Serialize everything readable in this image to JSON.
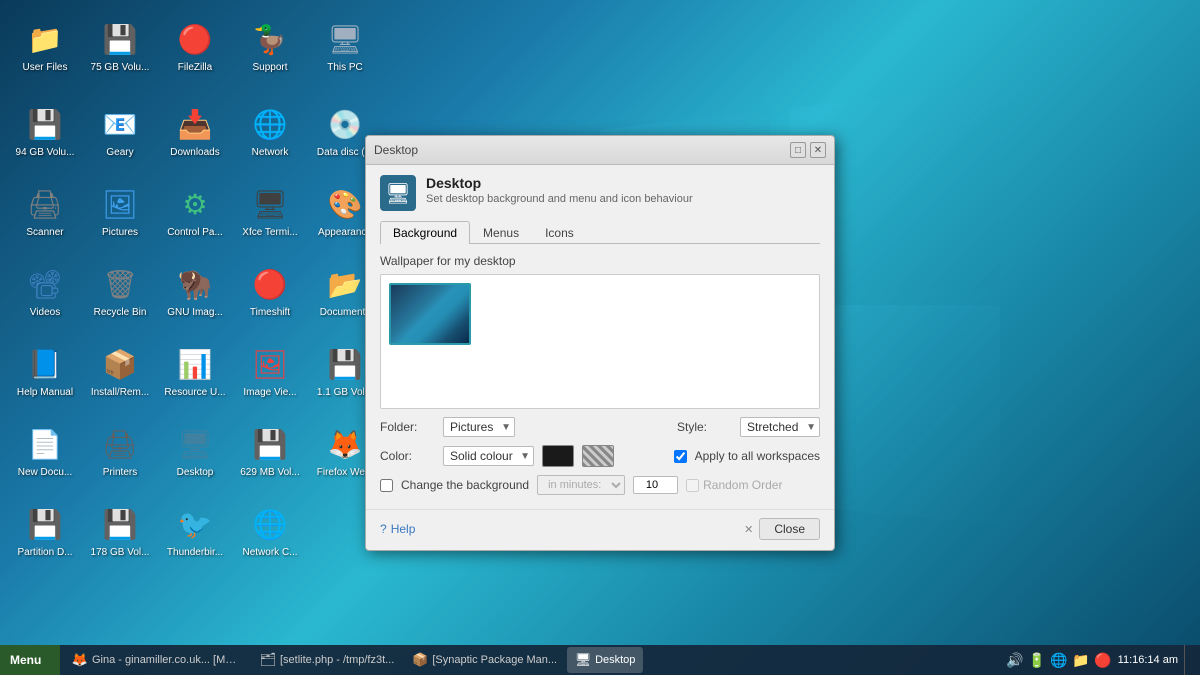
{
  "desktop": {
    "bg_color": "#1a6a8a",
    "icons": [
      {
        "id": "user-files",
        "label": "User Files",
        "emoji": "📁",
        "class": "icon-folder"
      },
      {
        "id": "75gb-vol",
        "label": "75 GB Volu...",
        "emoji": "💾",
        "class": "icon-drive"
      },
      {
        "id": "filezilla",
        "label": "FileZilla",
        "emoji": "🔴",
        "class": "icon-zip"
      },
      {
        "id": "support",
        "label": "Support",
        "emoji": "🦆",
        "class": "icon-support"
      },
      {
        "id": "this-pc",
        "label": "This PC",
        "emoji": "🖥",
        "class": "icon-pc"
      },
      {
        "id": "94gb-vol",
        "label": "94 GB Volu...",
        "emoji": "💾",
        "class": "icon-drive"
      },
      {
        "id": "geary",
        "label": "Geary",
        "emoji": "📧",
        "class": "icon-geary"
      },
      {
        "id": "downloads",
        "label": "Downloads",
        "emoji": "📥",
        "class": "icon-download"
      },
      {
        "id": "network",
        "label": "Network",
        "emoji": "🌐",
        "class": "icon-network"
      },
      {
        "id": "data-disc",
        "label": "Data disc (...",
        "emoji": "💿",
        "class": "icon-disc"
      },
      {
        "id": "scanner",
        "label": "Scanner",
        "emoji": "🖨",
        "class": "icon-scanner"
      },
      {
        "id": "pictures",
        "label": "Pictures",
        "emoji": "🖼",
        "class": "icon-pictures"
      },
      {
        "id": "control-panel",
        "label": "Control Pa...",
        "emoji": "⚙",
        "class": "icon-controlpanel"
      },
      {
        "id": "xfce-terminal",
        "label": "Xfce Termi...",
        "emoji": "🖥",
        "class": "icon-terminal"
      },
      {
        "id": "appearance",
        "label": "Appearance",
        "emoji": "🎨",
        "class": "icon-appearance"
      },
      {
        "id": "videos",
        "label": "Videos",
        "emoji": "📽",
        "class": "icon-videos"
      },
      {
        "id": "recycle-bin",
        "label": "Recycle Bin",
        "emoji": "🗑",
        "class": "icon-trash"
      },
      {
        "id": "gnu-image",
        "label": "GNU Imag...",
        "emoji": "🦬",
        "class": "icon-gnuimage"
      },
      {
        "id": "timeshift",
        "label": "Timeshift",
        "emoji": "🔴",
        "class": "icon-timeshift"
      },
      {
        "id": "documents",
        "label": "Documents",
        "emoji": "📂",
        "class": "icon-documents"
      },
      {
        "id": "help-manual",
        "label": "Help Manual",
        "emoji": "📘",
        "class": "icon-help"
      },
      {
        "id": "install-remove",
        "label": "Install/Rem...",
        "emoji": "📦",
        "class": "icon-install"
      },
      {
        "id": "resource-u",
        "label": "Resource U...",
        "emoji": "📊",
        "class": "icon-resource"
      },
      {
        "id": "image-view",
        "label": "Image Vie...",
        "emoji": "🖼",
        "class": "icon-imageview"
      },
      {
        "id": "1gb-vol",
        "label": "1.1 GB Vol...",
        "emoji": "💾",
        "class": "icon-volume"
      },
      {
        "id": "new-doc",
        "label": "New Docu...",
        "emoji": "📄",
        "class": "icon-newdoc"
      },
      {
        "id": "printers",
        "label": "Printers",
        "emoji": "🖨",
        "class": "icon-printers"
      },
      {
        "id": "desktop",
        "label": "Desktop",
        "emoji": "🖥",
        "class": "icon-desktop-icon"
      },
      {
        "id": "629gb-vol",
        "label": "629 MB Vol...",
        "emoji": "💾",
        "class": "icon-volume2"
      },
      {
        "id": "firefox-web",
        "label": "Firefox We...",
        "emoji": "🦊",
        "class": "icon-firefox"
      },
      {
        "id": "partition-d",
        "label": "Partition D...",
        "emoji": "💾",
        "class": "icon-partition"
      },
      {
        "id": "178gb-vol",
        "label": "178 GB Vol...",
        "emoji": "💾",
        "class": "icon-volume2"
      },
      {
        "id": "thunderbird",
        "label": "Thunderbir...",
        "emoji": "🐦",
        "class": "icon-thunderbird"
      },
      {
        "id": "network-c",
        "label": "Network C...",
        "emoji": "🌐",
        "class": "icon-network2"
      }
    ]
  },
  "dialog": {
    "title": "Desktop",
    "app_name": "Desktop",
    "app_description": "Set desktop background and menu and icon behaviour",
    "tabs": [
      {
        "id": "background",
        "label": "Background",
        "active": true
      },
      {
        "id": "menus",
        "label": "Menus",
        "active": false
      },
      {
        "id": "icons",
        "label": "Icons",
        "active": false
      }
    ],
    "background_tab": {
      "wallpaper_label": "Wallpaper for my desktop",
      "folder_label": "Folder:",
      "folder_value": "Pictures",
      "style_label": "Style:",
      "style_value": "Stretched",
      "color_label": "Color:",
      "color_value": "Solid colour",
      "change_bg_label": "Change the background",
      "in_minutes_label": "in minutes:",
      "minutes_value": "10",
      "random_order_label": "Random Order",
      "apply_label": "Apply to all workspaces"
    },
    "footer": {
      "help_label": "Help",
      "close_label": "Close"
    }
  },
  "taskbar": {
    "start_label": "Menu",
    "items": [
      {
        "id": "gina-firefox",
        "label": "Gina - ginamiller.co.uk... [Mozilla Firefox]",
        "active": false,
        "emoji": "🦊"
      },
      {
        "id": "setlite",
        "label": "[setlite.php - /tmp/fz3t...",
        "active": false,
        "emoji": "🗂"
      },
      {
        "id": "synaptic",
        "label": "[Synaptic Package Man...",
        "active": false,
        "emoji": "📦"
      },
      {
        "id": "desktop-active",
        "label": "Desktop",
        "active": true,
        "emoji": "🖥"
      }
    ],
    "clock": "11:16:14 am",
    "tray_icons": [
      "🔊",
      "🔋",
      "🌐",
      "📁",
      "🔴"
    ]
  }
}
